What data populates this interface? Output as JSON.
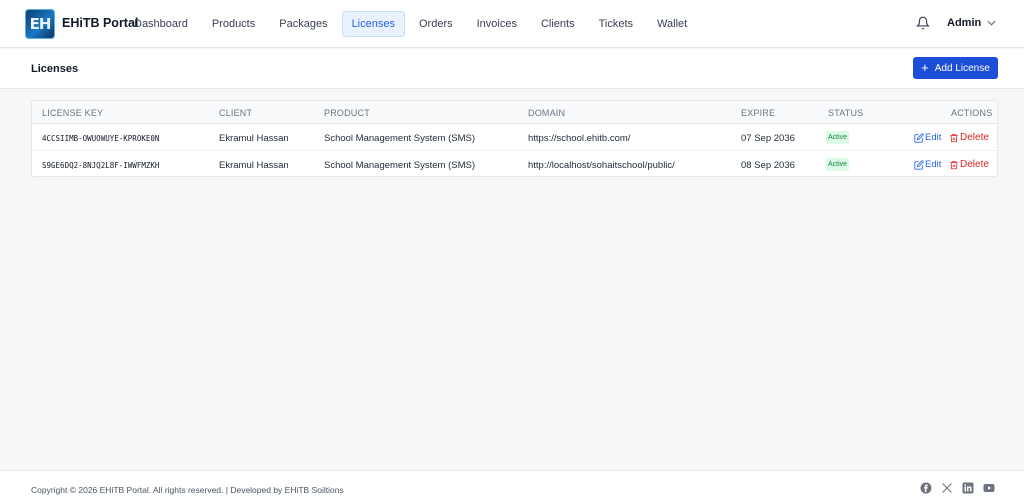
{
  "brand": {
    "logo_text": "EH",
    "name": "EHiTB Portal"
  },
  "nav": [
    {
      "label": "Dashboard"
    },
    {
      "label": "Products"
    },
    {
      "label": "Packages"
    },
    {
      "label": "Licenses",
      "active": true
    },
    {
      "label": "Orders"
    },
    {
      "label": "Invoices"
    },
    {
      "label": "Clients"
    },
    {
      "label": "Tickets"
    },
    {
      "label": "Wallet"
    }
  ],
  "user": {
    "name": "Admin",
    "notification_icon": "bell-icon",
    "menu_icon": "chevron-down-icon"
  },
  "page": {
    "title": "Licenses",
    "add_button": "Add License"
  },
  "table": {
    "columns": {
      "key": "LICENSE KEY",
      "client": "CLIENT",
      "product": "PRODUCT",
      "domain": "DOMAIN",
      "expire": "EXPIRE",
      "status": "STATUS",
      "actions": "ACTIONS"
    },
    "rows": [
      {
        "key": "4CCSIIMB-OWUOWUYE-KPROKE0N",
        "client": "Ekramul Hassan",
        "product": "School Management System (SMS)",
        "domain": "https://school.ehitb.com/",
        "expire": "07 Sep 2036",
        "status": "Active",
        "edit": "Edit",
        "delete": "Delete"
      },
      {
        "key": "S9GE6DQ2-8NJQ2L8F-IWWFMZKH",
        "client": "Ekramul Hassan",
        "product": "School Management System (SMS)",
        "domain": "http://localhost/sohaitschool/public/",
        "expire": "08 Sep 2036",
        "status": "Active",
        "edit": "Edit",
        "delete": "Delete"
      }
    ]
  },
  "footer": {
    "copyright": "Copyright © 2026 EHiTB Portal. All rights reserved. | Developed by EHiTB Soiltions",
    "social_icons": [
      "facebook-icon",
      "x-twitter-icon",
      "linkedin-icon",
      "youtube-icon"
    ]
  },
  "colors": {
    "primary": "#1d4ed8",
    "active_badge_bg": "#dcfce7",
    "active_badge_text": "#15803d",
    "delete": "#dc2626"
  }
}
